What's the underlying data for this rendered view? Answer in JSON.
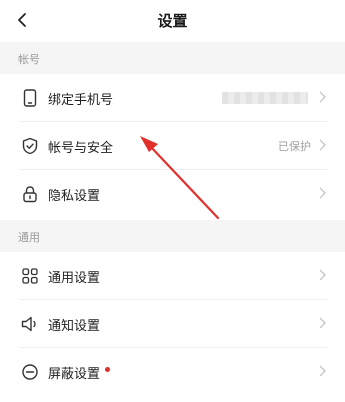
{
  "header": {
    "title": "设置",
    "back_icon": "chevron-left-icon"
  },
  "sections": {
    "account": {
      "title": "帐号"
    },
    "general": {
      "title": "通用"
    }
  },
  "rows": {
    "phone": {
      "label": "绑定手机号",
      "icon": "phone-icon"
    },
    "security": {
      "label": "帐号与安全",
      "value": "已保护",
      "icon": "shield-check-icon"
    },
    "privacy": {
      "label": "隐私设置",
      "icon": "lock-icon"
    },
    "general": {
      "label": "通用设置",
      "icon": "grid-icon"
    },
    "notify": {
      "label": "通知设置",
      "icon": "speaker-icon"
    },
    "block": {
      "label": "屏蔽设置",
      "icon": "minus-circle-icon",
      "badge_color": "#e0302c"
    }
  },
  "annotation_color": "#e0302c"
}
